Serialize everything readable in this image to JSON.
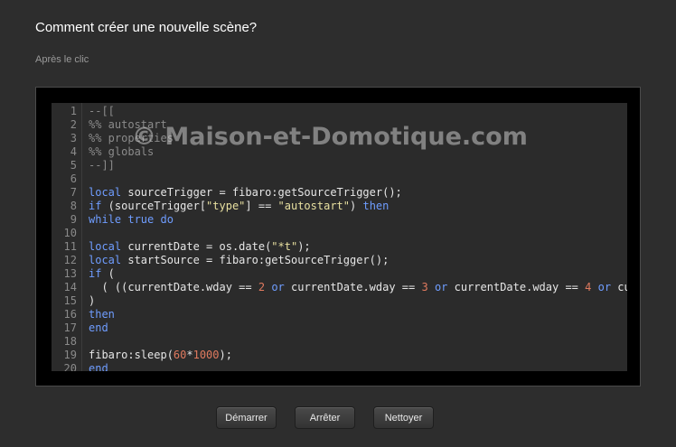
{
  "page": {
    "title": "Comment créer une nouvelle scène?",
    "subtitle": "Après le clic"
  },
  "watermark": "© Maison-et-Domotique.com",
  "editor": {
    "lines": [
      {
        "n": "1",
        "tokens": [
          {
            "t": "--[[",
            "c": "comment"
          }
        ]
      },
      {
        "n": "2",
        "tokens": [
          {
            "t": "%% autostart",
            "c": "comment"
          }
        ]
      },
      {
        "n": "3",
        "tokens": [
          {
            "t": "%% properties",
            "c": "comment"
          }
        ]
      },
      {
        "n": "4",
        "tokens": [
          {
            "t": "%% globals",
            "c": "comment"
          }
        ]
      },
      {
        "n": "5",
        "tokens": [
          {
            "t": "--]]",
            "c": "comment"
          }
        ]
      },
      {
        "n": "6",
        "tokens": []
      },
      {
        "n": "7",
        "tokens": [
          {
            "t": "local",
            "c": "keyword"
          },
          {
            "t": " sourceTrigger = fibaro:getSourceTrigger();",
            "c": "plain"
          }
        ]
      },
      {
        "n": "8",
        "tokens": [
          {
            "t": "if",
            "c": "keyword"
          },
          {
            "t": " (sourceTrigger[",
            "c": "plain"
          },
          {
            "t": "\"type\"",
            "c": "string"
          },
          {
            "t": "] == ",
            "c": "plain"
          },
          {
            "t": "\"autostart\"",
            "c": "string"
          },
          {
            "t": ") ",
            "c": "plain"
          },
          {
            "t": "then",
            "c": "keyword"
          }
        ]
      },
      {
        "n": "9",
        "tokens": [
          {
            "t": "while",
            "c": "keyword"
          },
          {
            "t": " ",
            "c": "plain"
          },
          {
            "t": "true",
            "c": "keyword"
          },
          {
            "t": " ",
            "c": "plain"
          },
          {
            "t": "do",
            "c": "keyword"
          }
        ]
      },
      {
        "n": "10",
        "tokens": []
      },
      {
        "n": "11",
        "tokens": [
          {
            "t": "local",
            "c": "keyword"
          },
          {
            "t": " currentDate = os.date(",
            "c": "plain"
          },
          {
            "t": "\"*t\"",
            "c": "string"
          },
          {
            "t": ");",
            "c": "plain"
          }
        ]
      },
      {
        "n": "12",
        "tokens": [
          {
            "t": "local",
            "c": "keyword"
          },
          {
            "t": " startSource = fibaro:getSourceTrigger();",
            "c": "plain"
          }
        ]
      },
      {
        "n": "13",
        "tokens": [
          {
            "t": "if",
            "c": "keyword"
          },
          {
            "t": " (",
            "c": "plain"
          }
        ]
      },
      {
        "n": "14",
        "tokens": [
          {
            "t": "  ( ((currentDate.wday == ",
            "c": "plain"
          },
          {
            "t": "2",
            "c": "number"
          },
          {
            "t": " ",
            "c": "plain"
          },
          {
            "t": "or",
            "c": "keyword"
          },
          {
            "t": " currentDate.wday == ",
            "c": "plain"
          },
          {
            "t": "3",
            "c": "number"
          },
          {
            "t": " ",
            "c": "plain"
          },
          {
            "t": "or",
            "c": "keyword"
          },
          {
            "t": " currentDate.wday == ",
            "c": "plain"
          },
          {
            "t": "4",
            "c": "number"
          },
          {
            "t": " ",
            "c": "plain"
          },
          {
            "t": "or",
            "c": "keyword"
          },
          {
            "t": " curren",
            "c": "plain"
          }
        ]
      },
      {
        "n": "15",
        "tokens": [
          {
            "t": ")",
            "c": "plain"
          }
        ]
      },
      {
        "n": "16",
        "tokens": [
          {
            "t": "then",
            "c": "keyword"
          }
        ]
      },
      {
        "n": "17",
        "tokens": [
          {
            "t": "end",
            "c": "keyword"
          }
        ]
      },
      {
        "n": "18",
        "tokens": []
      },
      {
        "n": "19",
        "tokens": [
          {
            "t": "fibaro:sleep(",
            "c": "plain"
          },
          {
            "t": "60",
            "c": "number"
          },
          {
            "t": "*",
            "c": "plain"
          },
          {
            "t": "1000",
            "c": "number"
          },
          {
            "t": ");",
            "c": "plain"
          }
        ]
      },
      {
        "n": "20",
        "tokens": [
          {
            "t": "end",
            "c": "keyword"
          }
        ]
      }
    ]
  },
  "buttons": {
    "start": "Démarrer",
    "stop": "Arrêter",
    "clear": "Nettoyer"
  }
}
